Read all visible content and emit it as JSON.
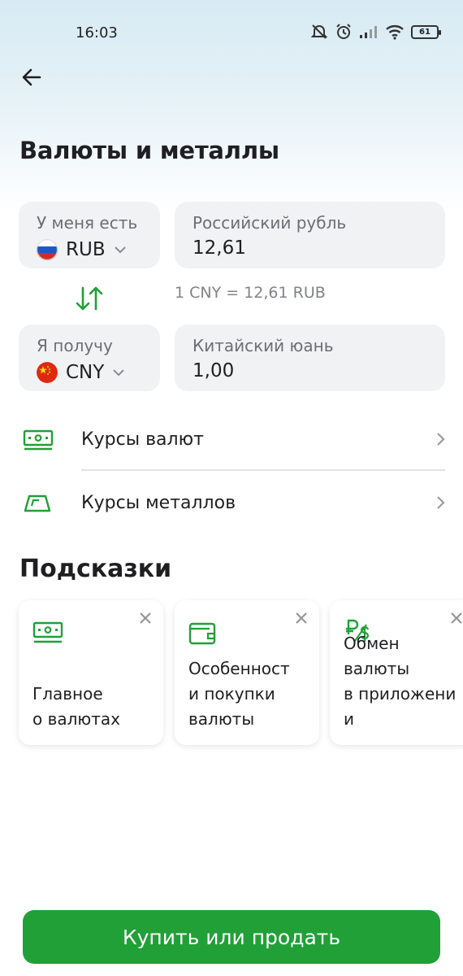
{
  "status_bar": {
    "time": "16:03",
    "battery": "61"
  },
  "header": {
    "title": "Валюты и металлы"
  },
  "converter": {
    "have": {
      "label": "У меня есть",
      "currency_code": "RUB",
      "currency_name": "Российский рубль",
      "amount": "12,61"
    },
    "rate_text": "1 CNY = 12,61 RUB",
    "get": {
      "label": "Я получу",
      "currency_code": "CNY",
      "currency_name": "Китайский юань",
      "amount": "1,00"
    }
  },
  "menu": [
    {
      "label": "Курсы валют",
      "icon": "banknote-icon"
    },
    {
      "label": "Курсы металлов",
      "icon": "ingot-icon"
    }
  ],
  "tips": {
    "title": "Подсказки",
    "cards": [
      {
        "text": "Главное\nо валютах",
        "icon": "banknote-icon"
      },
      {
        "text": "Особенност\nи покупки\nвалюты",
        "icon": "wallet-icon"
      },
      {
        "text": "Обмен\nвалюты\nв приложени\nи",
        "icon": "currency-exchange-icon"
      }
    ]
  },
  "cta": {
    "label": "Купить или продать"
  },
  "colors": {
    "accent": "#21a038",
    "card_bg": "#f1f2f4",
    "muted_text": "#6c6e73"
  }
}
